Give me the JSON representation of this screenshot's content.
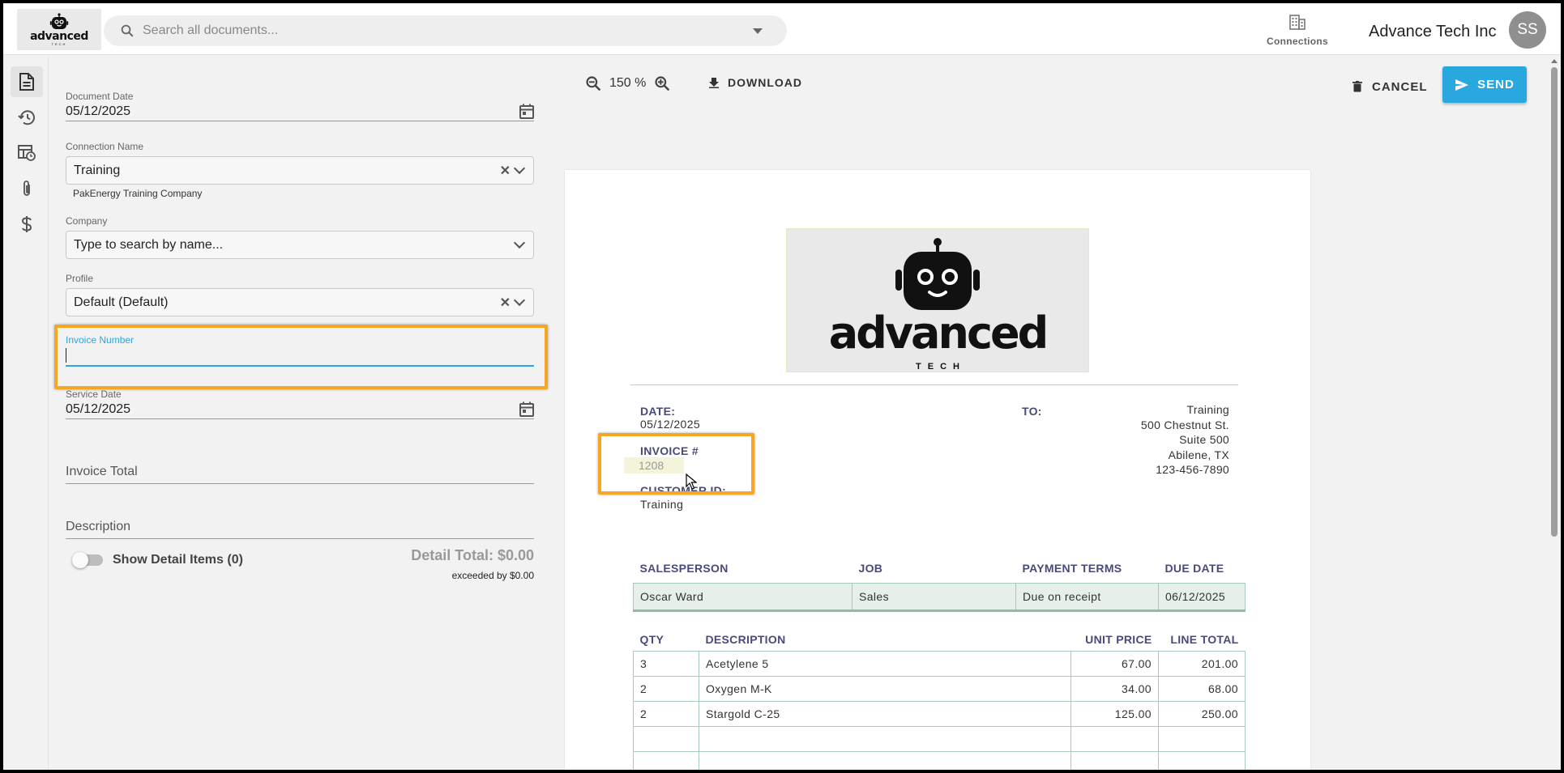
{
  "header": {
    "logo": {
      "word": "advanced",
      "sub": "TECH"
    },
    "search_placeholder": "Search all documents...",
    "connections_label": "Connections",
    "org_name": "Advance Tech Inc",
    "avatar_initials": "SS"
  },
  "colors": {
    "accent": "#29a8e0",
    "highlight": "#f5a623",
    "doc_label": "#4a4a7a"
  },
  "form": {
    "document_date": {
      "label": "Document Date",
      "value": "05/12/2025"
    },
    "connection_name": {
      "label": "Connection Name",
      "value": "Training",
      "helper": "PakEnergy Training Company"
    },
    "company": {
      "label": "Company",
      "placeholder": "Type to search by name..."
    },
    "profile": {
      "label": "Profile",
      "value": "Default (Default)"
    },
    "invoice_number": {
      "label": "Invoice Number",
      "value": ""
    },
    "service_date": {
      "label": "Service Date",
      "value": "05/12/2025"
    },
    "invoice_total": {
      "label": "Invoice Total"
    },
    "description": {
      "label": "Description"
    },
    "detail_toggle": {
      "label": "Show Detail Items (0)",
      "checked": false
    },
    "detail_total": "Detail Total: $0.00",
    "exceeded": "exceeded by $0.00"
  },
  "viewer": {
    "zoom_percent": "150 %",
    "download_label": "DOWNLOAD",
    "cancel_label": "CANCEL",
    "send_label": "SEND"
  },
  "document": {
    "logo": {
      "word": "advanced",
      "sub": "TECH"
    },
    "date_label": "DATE:",
    "date_value": "05/12/2025",
    "invoice_label": "INVOICE #",
    "invoice_value": "1208",
    "customer_label": "CUSTOMER ID:",
    "customer_value": "Training",
    "to_label": "TO:",
    "to_lines": [
      "Training",
      "500 Chestnut St.",
      "Suite 500",
      "Abilene, TX",
      "123-456-7890"
    ],
    "meta_headers": [
      "SALESPERSON",
      "JOB",
      "PAYMENT TERMS",
      "DUE DATE"
    ],
    "meta_values": [
      "Oscar Ward",
      "Sales",
      "Due on receipt",
      "06/12/2025"
    ],
    "item_headers": [
      "QTY",
      "DESCRIPTION",
      "UNIT PRICE",
      "LINE TOTAL"
    ],
    "items": [
      [
        "3",
        "Acetylene 5",
        "67.00",
        "201.00"
      ],
      [
        "2",
        "Oxygen M-K",
        "34.00",
        "68.00"
      ],
      [
        "2",
        "Stargold C-25",
        "125.00",
        "250.00"
      ],
      [
        "",
        "",
        "",
        ""
      ],
      [
        "",
        "",
        "",
        ""
      ]
    ]
  },
  "icons": {
    "rail": [
      "document-icon",
      "history-icon",
      "table-clock-icon",
      "paperclip-icon",
      "dollar-icon"
    ]
  }
}
